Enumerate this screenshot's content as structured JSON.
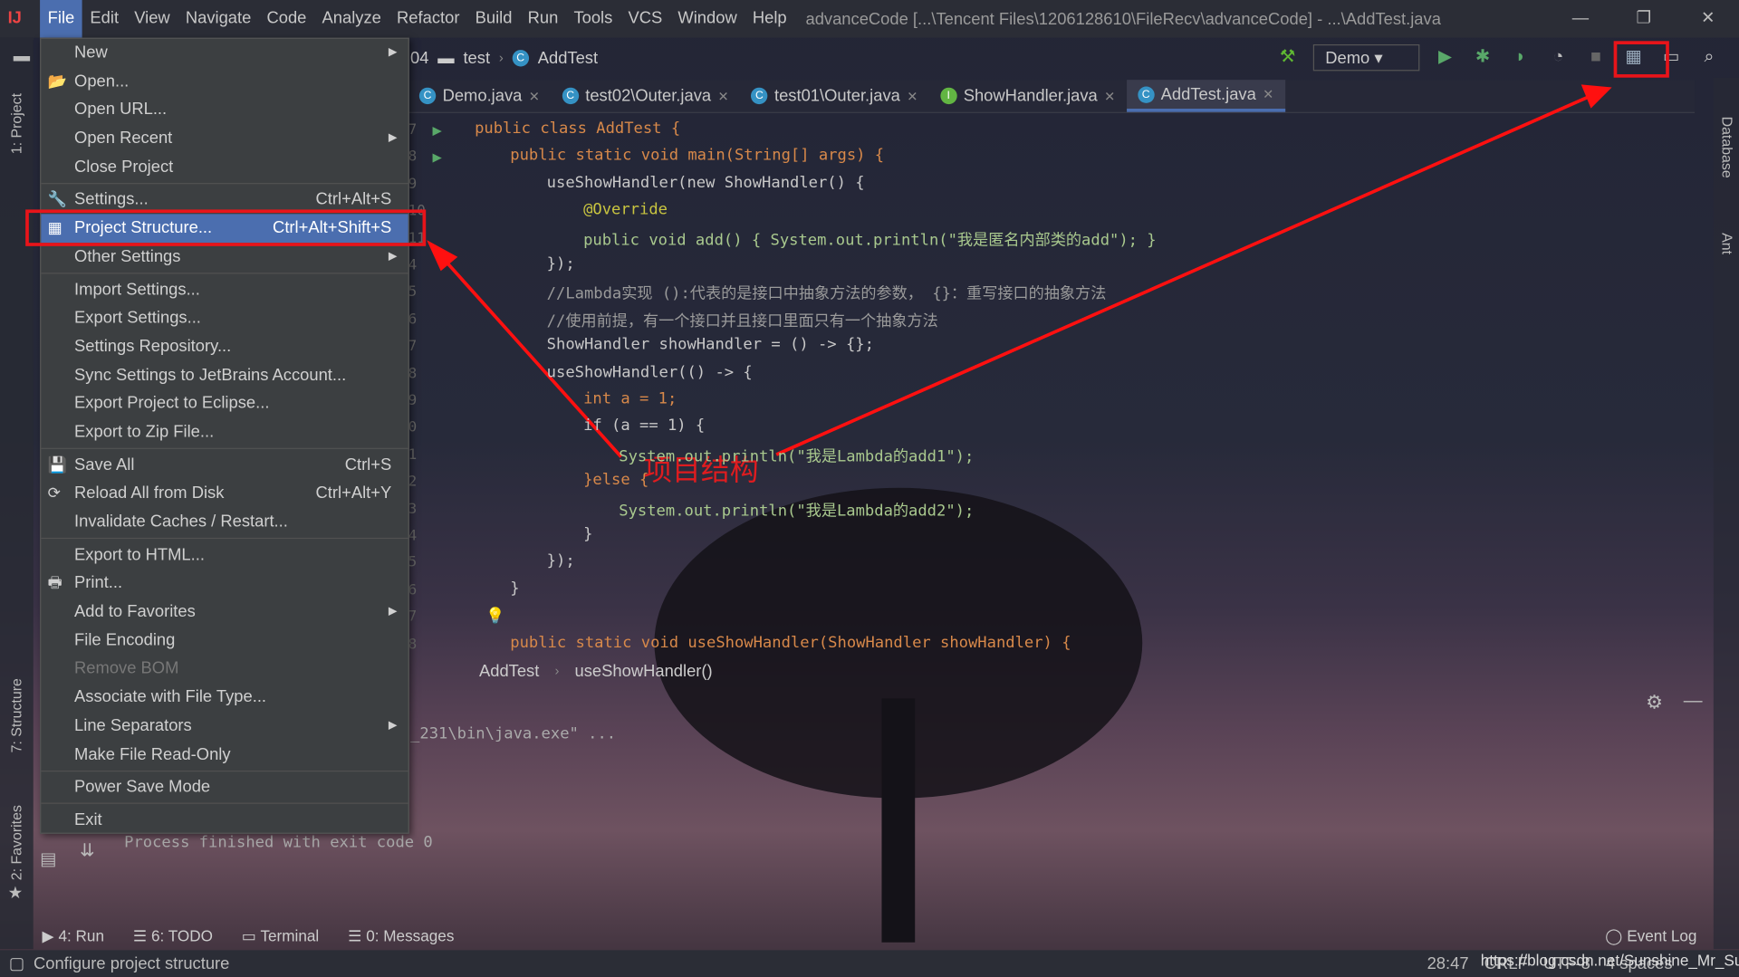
{
  "menubar": {
    "items": [
      "File",
      "Edit",
      "View",
      "Navigate",
      "Code",
      "Analyze",
      "Refactor",
      "Build",
      "Run",
      "Tools",
      "VCS",
      "Window",
      "Help"
    ],
    "title": "advanceCode [...\\Tencent Files\\1206128610\\FileRecv\\advanceCode] - ...\\AddTest.java"
  },
  "navbar": {
    "crumbs": [
      "04",
      "test",
      "AddTest"
    ],
    "run_config": "Demo"
  },
  "tabs": [
    {
      "label": "Demo.java",
      "icon": "C"
    },
    {
      "label": "test02\\Outer.java",
      "icon": "C"
    },
    {
      "label": "test01\\Outer.java",
      "icon": "C"
    },
    {
      "label": "ShowHandler.java",
      "icon": "I"
    },
    {
      "label": "AddTest.java",
      "icon": "C",
      "active": true
    }
  ],
  "code": {
    "line_numbers": [
      "7",
      "8",
      "9",
      "10",
      "11",
      "4",
      "5",
      "6",
      "7",
      "8",
      "9",
      "0",
      "1",
      "2",
      "3",
      "4",
      "5",
      "6",
      "7",
      "8"
    ],
    "lines": [
      "public class AddTest {",
      "public static void main(String[] args) {",
      "useShowHandler(new ShowHandler() {",
      "@Override",
      "public void add() { System.out.println(\"我是匿名内部类的add\"); }",
      "});",
      "//Lambda实现 ():代表的是接口中抽象方法的参数， {}：重写接口的抽象方法",
      "//使用前提，有一个接口并且接口里面只有一个抽象方法",
      "ShowHandler showHandler = () -> {};",
      "useShowHandler(() -> {",
      "int a = 1;",
      "if (a == 1) {",
      "System.out.println(\"我是Lambda的add1\");",
      "}else {",
      "System.out.println(\"我是Lambda的add2\");",
      "}",
      "});",
      "}",
      "",
      "public static void useShowHandler(ShowHandler showHandler) {"
    ]
  },
  "breadcrumb": [
    "AddTest",
    "useShowHandler()"
  ],
  "annotation": "项目结构",
  "file_menu": {
    "items": [
      {
        "label": "New",
        "submenu": true
      },
      {
        "label": "Open...",
        "icon": "folder-icon"
      },
      {
        "label": "Open URL..."
      },
      {
        "label": "Open Recent",
        "submenu": true
      },
      {
        "label": "Close Project",
        "sep_after": true
      },
      {
        "label": "Settings...",
        "shortcut": "Ctrl+Alt+S",
        "icon": "wrench-icon"
      },
      {
        "label": "Project Structure...",
        "shortcut": "Ctrl+Alt+Shift+S",
        "icon": "project-structure-icon",
        "selected": true
      },
      {
        "label": "Other Settings",
        "submenu": true,
        "sep_after": true
      },
      {
        "label": "Import Settings..."
      },
      {
        "label": "Export Settings..."
      },
      {
        "label": "Settings Repository..."
      },
      {
        "label": "Sync Settings to JetBrains Account..."
      },
      {
        "label": "Export Project to Eclipse..."
      },
      {
        "label": "Export to Zip File...",
        "sep_after": true
      },
      {
        "label": "Save All",
        "shortcut": "Ctrl+S",
        "icon": "save-icon"
      },
      {
        "label": "Reload All from Disk",
        "shortcut": "Ctrl+Alt+Y",
        "icon": "reload-icon"
      },
      {
        "label": "Invalidate Caches / Restart...",
        "sep_after": true
      },
      {
        "label": "Export to HTML..."
      },
      {
        "label": "Print...",
        "icon": "print-icon"
      },
      {
        "label": "Add to Favorites",
        "submenu": true
      },
      {
        "label": "File Encoding"
      },
      {
        "label": "Remove BOM",
        "disabled": true
      },
      {
        "label": "Associate with File Type..."
      },
      {
        "label": "Line Separators",
        "submenu": true
      },
      {
        "label": "Make File Read-Only",
        "sep_after": true
      },
      {
        "label": "Power Save Mode",
        "sep_after": true
      },
      {
        "label": "Exit"
      }
    ]
  },
  "run_panel": {
    "cmd": "_231\\bin\\java.exe\" ...",
    "output": "Process finished with exit code 0"
  },
  "left_tools": [
    "1: Project",
    "7: Structure",
    "2: Favorites"
  ],
  "right_tools": [
    "Database",
    "Ant"
  ],
  "bottom_tabs": [
    "4: Run",
    "6: TODO",
    "Terminal",
    "0: Messages"
  ],
  "event_log": "Event Log",
  "status": {
    "message": "Configure project structure",
    "position": "28:47",
    "line_sep": "CRLF",
    "encoding": "UTF-8",
    "indent": "4 spaces",
    "watermark": "https://blog.csdn.net/Sunshine_Mr_Sun"
  },
  "colors": {
    "accent": "#4b6eaf",
    "highlight_box": "#e8141a"
  }
}
